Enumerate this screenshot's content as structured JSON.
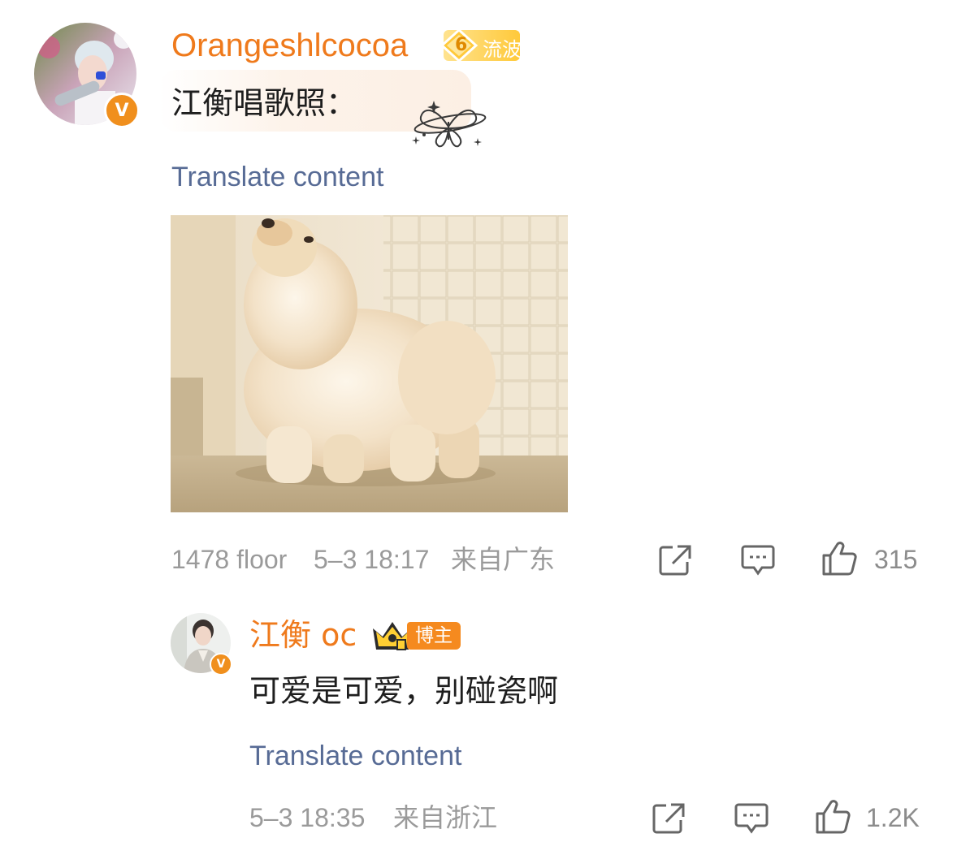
{
  "comment": {
    "username": "Orangeshlcocoa",
    "level_badge": {
      "level": "6",
      "label": "流波"
    },
    "text": "江衡唱歌照：",
    "translate_label": "Translate content",
    "image_alt": "fluffy cream chow chow puppy looking up",
    "meta": {
      "floor": "1478 floor",
      "time": "5–3 18:17",
      "location": "来自广东"
    },
    "actions": {
      "share_icon": "share-icon",
      "reply_icon": "comment-icon",
      "like_icon": "thumbs-up-icon",
      "like_count": "315"
    }
  },
  "reply": {
    "username": "江衡 oc",
    "badge_label": "博主",
    "text": "可爱是可爱，别碰瓷啊",
    "translate_label": "Translate content",
    "meta": {
      "time": "5–3 18:35",
      "location": "来自浙江"
    },
    "actions": {
      "share_icon": "share-icon",
      "reply_icon": "comment-icon",
      "like_icon": "thumbs-up-icon",
      "like_count": "1.2K"
    }
  },
  "colors": {
    "username": "#ef7a1c",
    "link": "#576b95",
    "meta": "#9a9a9a",
    "verified": "#f08f1d",
    "badge": "#ffc93a"
  }
}
